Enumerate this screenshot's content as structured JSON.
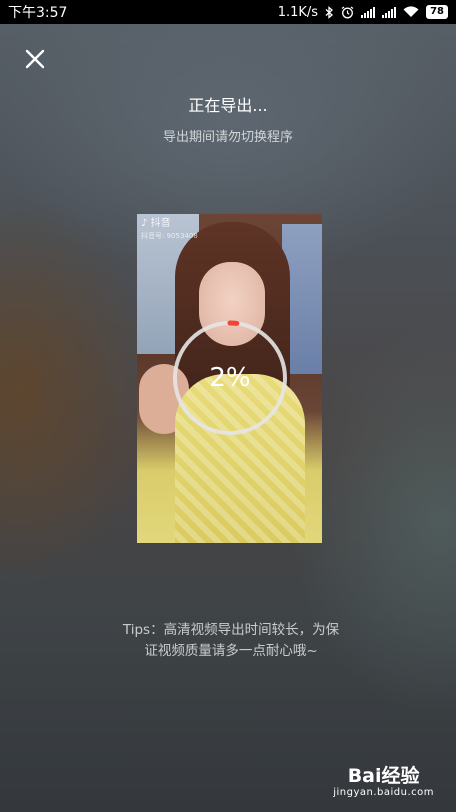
{
  "status_bar": {
    "time": "下午3:57",
    "network_speed": "1.1K/s",
    "battery": "78",
    "icons": [
      "bluetooth-icon",
      "alarm-icon",
      "signal-icon",
      "signal-icon",
      "wifi-icon",
      "battery-icon"
    ]
  },
  "header": {
    "close_icon": "close-icon",
    "title": "正在导出...",
    "subtitle": "导出期间请勿切换程序"
  },
  "preview": {
    "watermark_app": "抖音",
    "watermark_id": "抖音号: 9053408"
  },
  "progress": {
    "value": 0.02,
    "label": "2%",
    "track_color": "#e6e6e6",
    "fill_color": "#f0453a"
  },
  "tips": {
    "line1": "Tips：高清视频导出时间较长，为保",
    "line2": "证视频质量请多一点耐心哦~"
  },
  "watermark": {
    "logo": "Bai经验",
    "url": "jingyan.baidu.com"
  }
}
